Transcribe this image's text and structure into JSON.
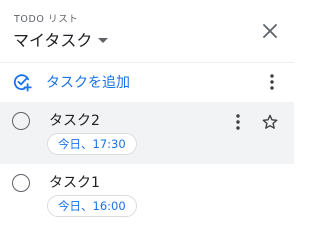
{
  "header": {
    "kicker": "TODO リスト",
    "list_name": "マイタスク"
  },
  "add_task": {
    "label": "タスクを追加"
  },
  "tasks": [
    {
      "title": "タスク2",
      "due": "今日、17:30"
    },
    {
      "title": "タスク1",
      "due": "今日、16:00"
    }
  ],
  "colors": {
    "accent": "#1a73e8",
    "text": "#202124",
    "icon": "#5f6368",
    "hover_row": "#f1f3f4",
    "chip_border": "#dadce0"
  },
  "icons": {
    "close": "close-icon",
    "dropdown": "chevron-down-icon",
    "add_task": "add-task-check-icon",
    "more": "more-vert-icon",
    "star": "star-outline-icon",
    "checkbox": "circle-checkbox-icon"
  }
}
